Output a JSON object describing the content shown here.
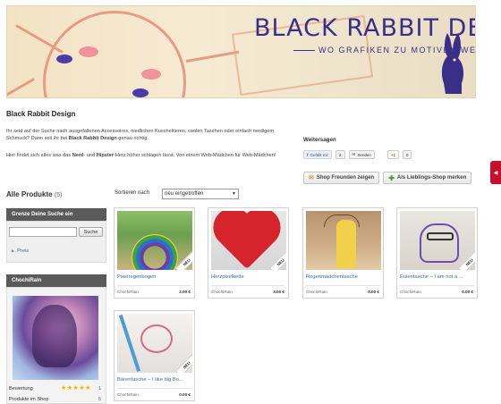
{
  "banner": {
    "title": "BLACK RABBIT DESIGN",
    "subtitle": "WO GRAFIKEN ZU MOTIVEN WERDEN",
    "colors": {
      "accent": "#3a2e88",
      "sun": "#e99a82",
      "background": "#f3e3c4"
    }
  },
  "shop": {
    "name": "Black Rabbit Design",
    "intro_p1_a": "Ihr seid auf der Suche nach ausgefallenen Accessoires, niedlichen Kuscheltieren, coolen Taschen oder einfach nerdigem Schmuck? Dann seit ihr bei ",
    "intro_p1_strong": "Black Rabbit Design",
    "intro_p1_b": " genau richtig.",
    "intro_p2_a": "Hier findet sich alles was das ",
    "intro_p2_strong1": "Nerd",
    "intro_p2_mid": "- und ",
    "intro_p2_strong2": "Hipster",
    "intro_p2_b": "-Herz höher schlagen lässt. Von einem Web-Mädchen für Web-Mädchen!"
  },
  "share": {
    "title": "Weitersagen",
    "facebook_label": "Gefällt mir",
    "count_badge": "2",
    "send_label": "Senden",
    "gplus_label": "+1",
    "gplus_count": "0",
    "tell_friends": "Shop Freunden zeigen",
    "favorite": "Als Lieblings-Shop merken"
  },
  "products_header": {
    "title": "Alle Produkte",
    "count": "(5)",
    "sort_label": "Sortieren nach",
    "sort_selected": "neu eingetroffen"
  },
  "filter": {
    "title": "Grenze Deine Suche ein",
    "search_placeholder": "",
    "search_button": "Suche",
    "price_link": "Preis"
  },
  "profile": {
    "name": "ChochiRain",
    "rating_label": "Bewertung",
    "stars": "★★★★★",
    "rating_count": "1",
    "products_label": "Produkte im Shop",
    "products_count": "5"
  },
  "products": [
    {
      "name": "Pixelregenbogen",
      "seller": "ChochiRain",
      "price": "2.00 €",
      "badge": "NEU"
    },
    {
      "name": "Herzpixelkette",
      "seller": "ChochiRain",
      "price": "3.00 €",
      "badge": "NEU"
    },
    {
      "name": "Regenmädchentasche",
      "seller": "ChochiRain",
      "price": "0.00 €",
      "badge": "NEU"
    },
    {
      "name": "Eulentasche – I am not a ...",
      "seller": "ChochiRain",
      "price": "0.00 €",
      "badge": "NEU"
    },
    {
      "name": "Bärentasche – I like big Bo...",
      "seller": "ChochiRain",
      "price": "0.00 €",
      "badge": "NEU"
    }
  ],
  "side_tab": {
    "icon": "chevron-left-icon"
  }
}
